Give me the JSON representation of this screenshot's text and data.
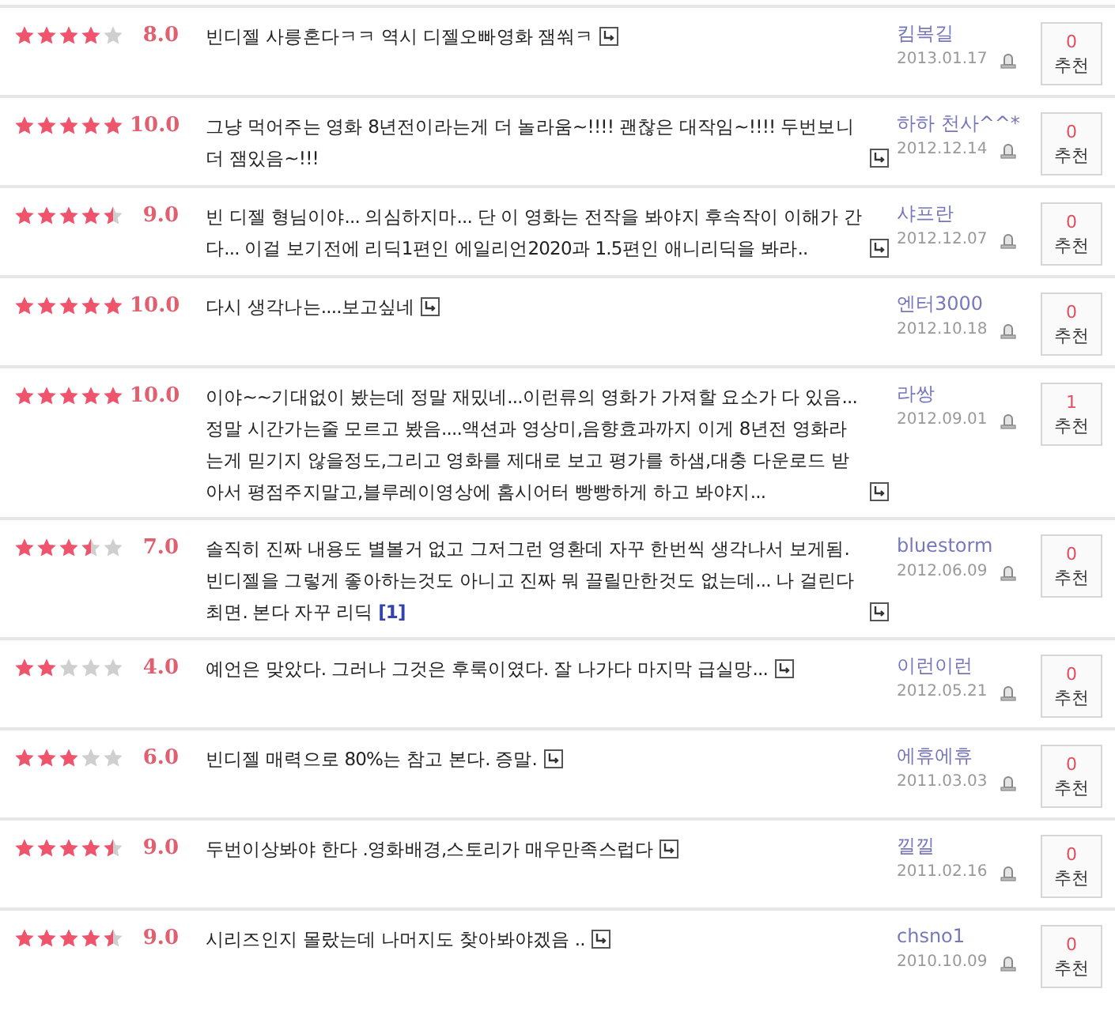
{
  "reviews": [
    {
      "stars": 4,
      "score": "8.0",
      "comment": "빈디젤 사릉혼다ㅋㅋ 역시 디젤오빠영화 잼쒀ㅋ",
      "user": "킴복길",
      "date": "2013.01.17",
      "recommend_count": "0",
      "recommend_label": "추천"
    },
    {
      "stars": 5,
      "score": "10.0",
      "comment": "그냥 먹어주는 영화 8년전이라는게 더 놀라움~!!!! 괜찮은 대작임~!!!! 두번보니 더 잼있음~!!!",
      "user": "하하 천사^^*",
      "date": "2012.12.14",
      "recommend_count": "0",
      "recommend_label": "추천"
    },
    {
      "stars": 4.5,
      "score": "9.0",
      "comment": "빈 디젤 형님이야... 의심하지마... 단 이 영화는 전작을 봐야지 후속작이 이해가 간다... 이걸 보기전에 리딕1편인 에일리언2020과 1.5편인 애니리딕을 봐라..",
      "user": "샤프란",
      "date": "2012.12.07",
      "recommend_count": "0",
      "recommend_label": "추천"
    },
    {
      "stars": 5,
      "score": "10.0",
      "comment": "다시 생각나는....보고싶네",
      "user": "엔터3000",
      "date": "2012.10.18",
      "recommend_count": "0",
      "recommend_label": "추천"
    },
    {
      "stars": 5,
      "score": "10.0",
      "comment": "이야~~기대없이 봤는데 정말 재밌네...이런류의 영화가 가져할 요소가 다 있음...정말 시간가는줄 모르고 봤음....액션과 영상미,음향효과까지 이게 8년전 영화라는게 믿기지 않을정도,그리고 영화를 제대로 보고 평가를 하샘,대충 다운로드 받아서 평점주지말고,블루레이영상에 홈시어터 빵빵하게 하고 봐야지...",
      "user": "라쌍",
      "date": "2012.09.01",
      "recommend_count": "1",
      "recommend_label": "추천"
    },
    {
      "stars": 3.5,
      "score": "7.0",
      "comment": "솔직히 진짜 내용도 별볼거 없고 그저그런 영환데 자꾸 한번씩 생각나서 보게됨. 빈디젤을 그렇게 좋아하는것도 아니고 진짜 뭐 끌릴만한것도 없는데... 나 걸린다 최면. 본다 자꾸 리딕",
      "link": "[1]",
      "user": "bluestorm",
      "date": "2012.06.09",
      "recommend_count": "0",
      "recommend_label": "추천"
    },
    {
      "stars": 2,
      "score": "4.0",
      "comment": "예언은 맞았다. 그러나 그것은 후룩이였다. 잘 나가다 마지막 급실망...",
      "user": "이런이런",
      "date": "2012.05.21",
      "recommend_count": "0",
      "recommend_label": "추천"
    },
    {
      "stars": 3,
      "score": "6.0",
      "comment": "빈디젤 매력으로 80%는 참고 본다. 증말.",
      "user": "에휴에휴",
      "date": "2011.03.03",
      "recommend_count": "0",
      "recommend_label": "추천"
    },
    {
      "stars": 4.5,
      "score": "9.0",
      "comment": "두번이상봐야 한다 .영화배경,스토리가 매우만족스럽다",
      "user": "낄낄",
      "date": "2011.02.16",
      "recommend_count": "0",
      "recommend_label": "추천"
    },
    {
      "stars": 4.5,
      "score": "9.0",
      "comment": "시리즈인지 몰랐는데 나머지도 찾아봐야겠음 ..",
      "user": "chsno1",
      "date": "2010.10.09",
      "recommend_count": "0",
      "recommend_label": "추천"
    }
  ]
}
